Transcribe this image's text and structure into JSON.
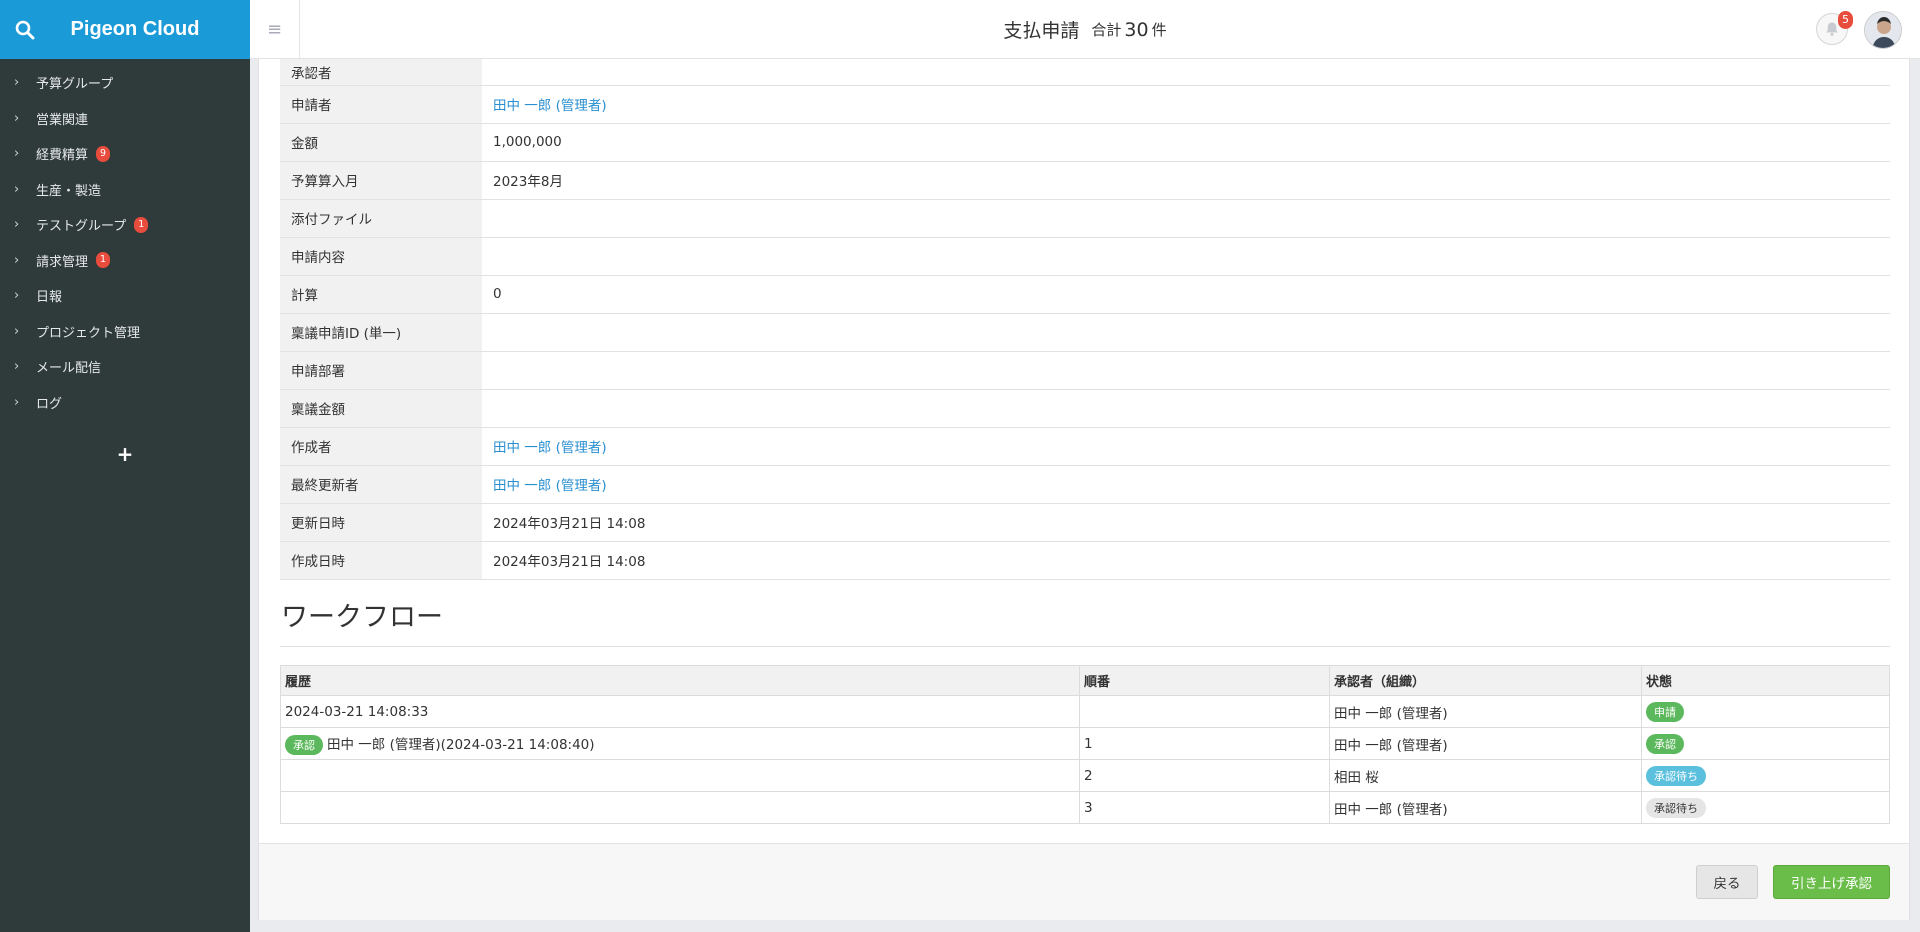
{
  "brand": {
    "title": "Pigeon Cloud"
  },
  "sidebar": {
    "items": [
      {
        "label": "予算グループ",
        "badge": ""
      },
      {
        "label": "営業関連",
        "badge": ""
      },
      {
        "label": "経費精算",
        "badge": "9"
      },
      {
        "label": "生産・製造",
        "badge": ""
      },
      {
        "label": "テストグループ",
        "badge": "1"
      },
      {
        "label": "請求管理",
        "badge": "1"
      },
      {
        "label": "日報",
        "badge": ""
      },
      {
        "label": "プロジェクト管理",
        "badge": ""
      },
      {
        "label": "メール配信",
        "badge": ""
      },
      {
        "label": "ログ",
        "badge": ""
      }
    ],
    "add_label": "+"
  },
  "header": {
    "title": "支払申請",
    "total_prefix": "合計",
    "total_count": "30",
    "total_suffix": "件",
    "notification_count": "5"
  },
  "detail": {
    "rows": [
      {
        "label": "承認者",
        "value": "",
        "link": false
      },
      {
        "label": "申請者",
        "value": "田中 一郎 (管理者)",
        "link": true
      },
      {
        "label": "金額",
        "value": "1,000,000",
        "link": false
      },
      {
        "label": "予算算入月",
        "value": "2023年8月",
        "link": false
      },
      {
        "label": "添付ファイル",
        "value": "",
        "link": false
      },
      {
        "label": "申請内容",
        "value": "",
        "link": false
      },
      {
        "label": "計算",
        "value": "0",
        "link": false
      },
      {
        "label": "稟議申請ID (単一)",
        "value": "",
        "link": false
      },
      {
        "label": "申請部署",
        "value": "",
        "link": false
      },
      {
        "label": "稟議金額",
        "value": "",
        "link": false
      },
      {
        "label": "作成者",
        "value": "田中 一郎 (管理者)",
        "link": true
      },
      {
        "label": "最終更新者",
        "value": "田中 一郎 (管理者)",
        "link": true
      },
      {
        "label": "更新日時",
        "value": "2024年03月21日 14:08",
        "link": false
      },
      {
        "label": "作成日時",
        "value": "2024年03月21日 14:08",
        "link": false
      }
    ]
  },
  "workflow": {
    "title": "ワークフロー",
    "headers": {
      "history": "履歴",
      "order": "順番",
      "approver": "承認者（組織）",
      "status": "状態"
    },
    "rows": [
      {
        "history_badge": "",
        "history": "2024-03-21 14:08:33",
        "order": "",
        "approver": "田中 一郎 (管理者)",
        "status": "申請",
        "status_style": "green"
      },
      {
        "history_badge": "承認",
        "history": "田中 一郎 (管理者)(2024-03-21 14:08:40)",
        "order": "1",
        "approver": "田中 一郎 (管理者)",
        "status": "承認",
        "status_style": "green"
      },
      {
        "history_badge": "",
        "history": "",
        "order": "2",
        "approver": "相田 桜",
        "status": "承認待ち",
        "status_style": "blue"
      },
      {
        "history_badge": "",
        "history": "",
        "order": "3",
        "approver": "田中 一郎 (管理者)",
        "status": "承認待ち",
        "status_style": "gray"
      }
    ]
  },
  "footer": {
    "back_label": "戻る",
    "approve_label": "引き上げ承認"
  },
  "colors": {
    "brand": "#1a9ad6",
    "sidebar": "#2f3a3b",
    "link": "#2a8fd0",
    "approve": "#6bbd4a",
    "badge": "#e74c3c"
  }
}
